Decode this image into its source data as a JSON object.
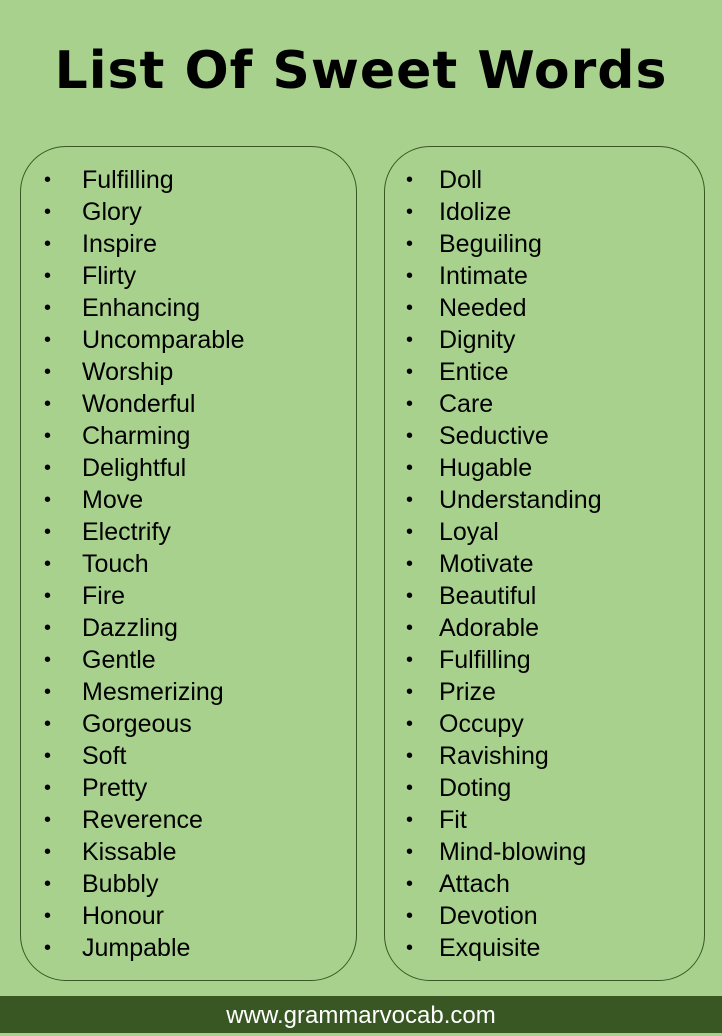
{
  "title": "List Of Sweet Words",
  "bullet_glyph": "•",
  "columns": [
    {
      "words": [
        "Fulfilling",
        "Glory",
        "Inspire",
        "Flirty",
        "Enhancing",
        "Uncomparable",
        "Worship",
        "Wonderful",
        "Charming",
        "Delightful",
        "Move",
        "Electrify",
        "Touch",
        "Fire",
        "Dazzling",
        "Gentle",
        "Mesmerizing",
        "Gorgeous",
        "Soft",
        "Pretty",
        "Reverence",
        "Kissable",
        "Bubbly",
        "Honour",
        "Jumpable"
      ]
    },
    {
      "words": [
        "Doll",
        "Idolize",
        "Beguiling",
        "Intimate",
        "Needed",
        "Dignity",
        "Entice",
        "Care",
        "Seductive",
        "Hugable",
        "Understanding",
        "Loyal",
        "Motivate",
        "Beautiful",
        "Adorable",
        "Fulfilling",
        "Prize",
        "Occupy",
        "Ravishing",
        "Doting",
        "Fit",
        "Mind-blowing",
        "Attach",
        "Devotion",
        "Exquisite"
      ]
    }
  ],
  "footer": {
    "text": "www.grammarvocab.com"
  },
  "colors": {
    "background": "#a9d18e",
    "border": "#385723",
    "footer_bg": "#385723",
    "footer_text": "#ffffff"
  }
}
